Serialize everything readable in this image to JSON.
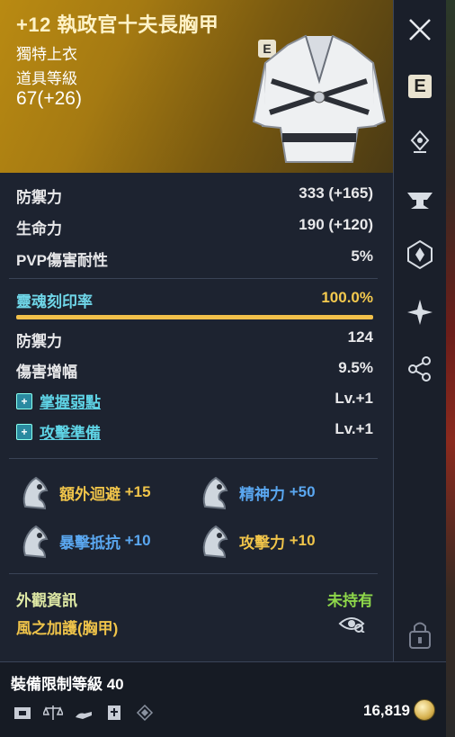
{
  "item": {
    "title": "+12 執政官十夫長胸甲",
    "type": "獨特上衣",
    "ilvl_label": "道具等級",
    "ilvl": "67(+26)",
    "grade_badge": "E"
  },
  "stats": [
    {
      "label": "防禦力",
      "value": "333 (+165)"
    },
    {
      "label": "生命力",
      "value": "190 (+120)"
    },
    {
      "label": "PVP傷害耐性",
      "value": "5%"
    }
  ],
  "soul": {
    "label": "靈魂刻印率",
    "value": "100.0%",
    "progress": 1.0,
    "stats": [
      {
        "label": "防禦力",
        "value": "124"
      },
      {
        "label": "傷害增幅",
        "value": "9.5%"
      }
    ],
    "skills": [
      {
        "name": "掌握弱點",
        "value": "Lv.+1"
      },
      {
        "name": "攻擊準備",
        "value": "Lv.+1"
      }
    ]
  },
  "manastones": [
    {
      "label": "額外迴避",
      "bonus": "+15",
      "color": "gold"
    },
    {
      "label": "精神力",
      "bonus": "+50",
      "color": "blue"
    },
    {
      "label": "暴擊抵抗",
      "bonus": "+10",
      "color": "blue"
    },
    {
      "label": "攻擊力",
      "bonus": "+10",
      "color": "gold"
    }
  ],
  "appearance": {
    "label": "外觀資訊",
    "status": "未持有",
    "name": "風之加護(胸甲)"
  },
  "footer": {
    "requirement": "裝備限制等級 40",
    "price": "16,819"
  },
  "sidebar": [
    "close-icon",
    "e-grade-icon",
    "upgrade-icon",
    "anvil-icon",
    "soul-icon",
    "sparkle-icon",
    "share-icon",
    "lock-icon"
  ],
  "colors": {
    "accent_gold": "#f0c44a",
    "soul_cyan": "#5fd4e6",
    "stone_blue": "#5aa7f0",
    "owned_green": "#8ed84a"
  }
}
